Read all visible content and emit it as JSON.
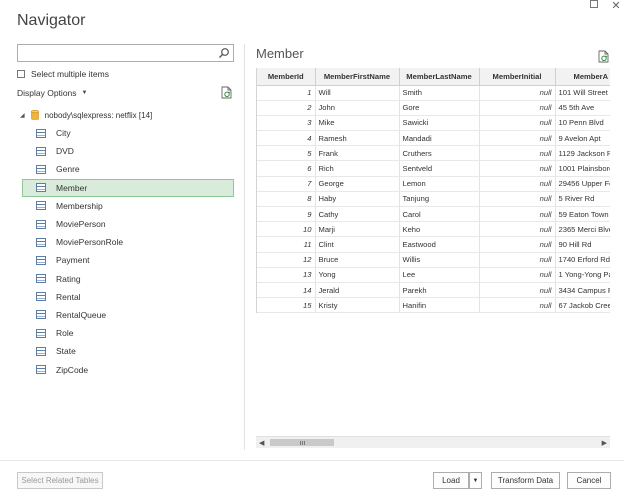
{
  "window": {
    "title": "Navigator"
  },
  "search": {
    "placeholder": ""
  },
  "left": {
    "select_multiple_label": "Select multiple items",
    "display_options_label": "Display Options",
    "root_label": "nobody\\sqlexpress: netflix [14]",
    "items": [
      {
        "label": "City"
      },
      {
        "label": "DVD"
      },
      {
        "label": "Genre"
      },
      {
        "label": "Member",
        "selected": true
      },
      {
        "label": "Membership"
      },
      {
        "label": "MoviePerson"
      },
      {
        "label": "MoviePersonRole"
      },
      {
        "label": "Payment"
      },
      {
        "label": "Rating"
      },
      {
        "label": "Rental"
      },
      {
        "label": "RentalQueue"
      },
      {
        "label": "Role"
      },
      {
        "label": "State"
      },
      {
        "label": "ZipCode"
      }
    ]
  },
  "preview": {
    "title": "Member",
    "columns": [
      "MemberId",
      "MemberFirstName",
      "MemberLastName",
      "MemberInitial",
      "MemberA"
    ],
    "rows": [
      [
        "1",
        "Will",
        "Smith",
        "null",
        "101 Will Street"
      ],
      [
        "2",
        "John",
        "Gore",
        "null",
        "45 5th Ave"
      ],
      [
        "3",
        "Mike",
        "Sawicki",
        "null",
        "10 Penn Blvd"
      ],
      [
        "4",
        "Ramesh",
        "Mandadi",
        "null",
        "9 Avelon Apt"
      ],
      [
        "5",
        "Frank",
        "Cruthers",
        "null",
        "1129 Jackson Ro"
      ],
      [
        "6",
        "Rich",
        "Sentveld",
        "null",
        "1001 Plainsbord"
      ],
      [
        "7",
        "George",
        "Lemon",
        "null",
        "29456 Upper Fe"
      ],
      [
        "8",
        "Haby",
        "Tanjung",
        "null",
        "5 River Rd"
      ],
      [
        "9",
        "Cathy",
        "Carol",
        "null",
        "59 Eaton Town"
      ],
      [
        "10",
        "Marji",
        "Keho",
        "null",
        "2365 Merci Blvc"
      ],
      [
        "11",
        "Clint",
        "Eastwood",
        "null",
        "90 Hill Rd"
      ],
      [
        "12",
        "Bruce",
        "Willis",
        "null",
        "1740 Erford Rd"
      ],
      [
        "13",
        "Yong",
        "Lee",
        "null",
        "1 Yong-Yong Pa"
      ],
      [
        "14",
        "Jerald",
        "Parekh",
        "null",
        "3434 Campus R"
      ],
      [
        "15",
        "Kristy",
        "Hanifin",
        "null",
        "67 Jackob Creek"
      ]
    ]
  },
  "footer": {
    "select_related": "Select Related Tables",
    "load": "Load",
    "transform": "Transform Data",
    "cancel": "Cancel"
  },
  "colors": {
    "selection_bg": "#d9ecdb",
    "selection_border": "#8cc795",
    "table_icon": "#5c7da8"
  }
}
